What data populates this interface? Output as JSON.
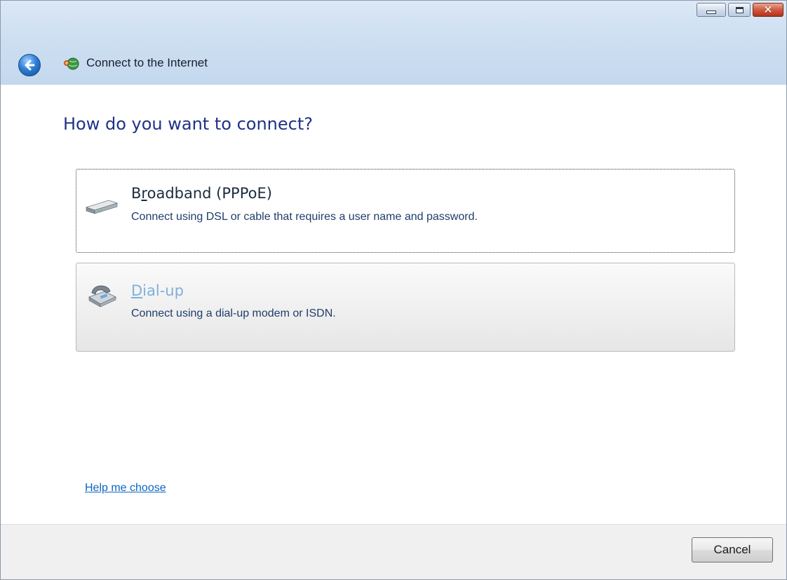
{
  "window": {
    "title": "Connect to the Internet",
    "caption_buttons": [
      "minimize",
      "maximize",
      "close"
    ],
    "close_glyph": "✕"
  },
  "heading": "How do you want to connect?",
  "options": [
    {
      "id": "broadband",
      "title_pre": "B",
      "title_access": "r",
      "title_post": "oadband (PPPoE)",
      "description": "Connect using DSL or cable that requires a user name and password.",
      "icon": "broadband-modem-icon",
      "state": "focused"
    },
    {
      "id": "dialup",
      "title_pre": "",
      "title_access": "D",
      "title_post": "ial-up",
      "description": "Connect using a dial-up modem or ISDN.",
      "icon": "telephone-modem-icon",
      "state": "hover"
    }
  ],
  "help_link": "Help me choose",
  "footer": {
    "cancel_label": "Cancel"
  },
  "colors": {
    "heading": "#1e3287",
    "link": "#0b66c2",
    "dialup_title": "#7fb0dd",
    "header_bg": "#cddff1"
  }
}
